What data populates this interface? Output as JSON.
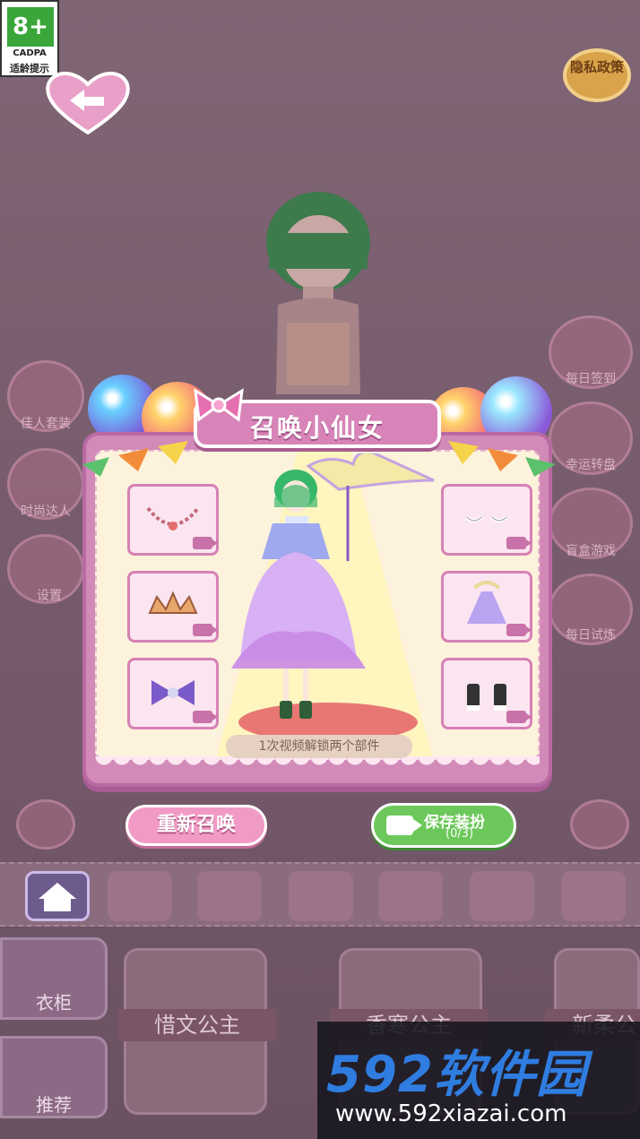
{
  "age_badge": {
    "rating": "8+",
    "org": "CADPA",
    "tip": "适龄提示"
  },
  "privacy": {
    "label": "隐私政策"
  },
  "side_left": [
    "佳人套装",
    "时尚达人",
    "设置"
  ],
  "side_right": [
    "每日签到",
    "幸运转盘",
    "盲盒游戏",
    "每日试炼"
  ],
  "dialog": {
    "title": "召唤小仙女",
    "hint": "1次视频解锁两个部件",
    "slots_left": [
      "necklace-item",
      "crown-item",
      "bow-item"
    ],
    "slots_right": [
      "eyes-item",
      "dress-item",
      "shoes-item"
    ]
  },
  "buttons": {
    "resummon": "重新召唤",
    "save": "保存装扮",
    "save_count": "(0/3)"
  },
  "toolbar": [
    "home-icon",
    "face-icon",
    "head-icon",
    "ears-icon",
    "face2-icon",
    "hair-icon",
    "hair2-icon"
  ],
  "tabs": {
    "wardrobe": "衣柜",
    "recommend": "推荐"
  },
  "cards": [
    "惜文公主",
    "香寒公主",
    "新柔公"
  ],
  "watermark": {
    "logo": "592软件园",
    "url": "www.592xiazai.com"
  },
  "colors": {
    "accent": "#d884b8",
    "save_green": "#6cc85a",
    "privacy_gold": "#d9a34b"
  }
}
